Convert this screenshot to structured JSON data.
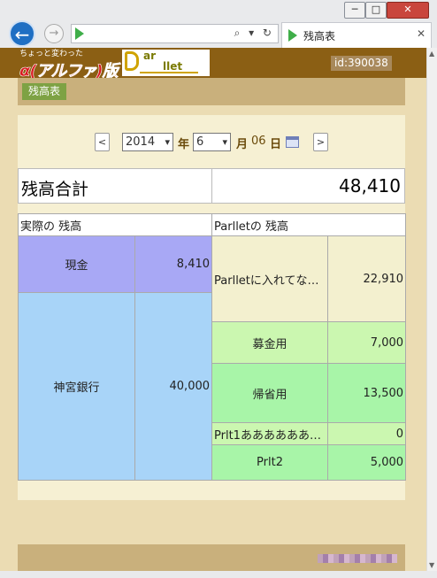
{
  "browser": {
    "tab_title": "残高表",
    "window_buttons": {
      "minimize": "─",
      "maximize": "□",
      "close": "✕"
    },
    "back_icon": "←",
    "forward_icon": "→",
    "address_tools": "⌕ ▾ ↻",
    "tab_close": "✕"
  },
  "header": {
    "logo_tagline": "ちょっと変わった",
    "logo_main": "α(アルファ)版",
    "brand_line1": "ar",
    "brand_line2": "llet",
    "user_id": "id:390038"
  },
  "nav": {
    "active_tab": "残高表"
  },
  "date": {
    "prev_label": "<",
    "next_label": ">",
    "year": "2014",
    "year_unit": "年",
    "month": "6",
    "month_unit": "月",
    "day": "06",
    "day_unit": "日",
    "dropdown_icon": "▾"
  },
  "total": {
    "label": "残高合計",
    "value": "48,410"
  },
  "table": {
    "left_header": "実際の 残高",
    "right_header": "Parlletの 残高",
    "actual": [
      {
        "name": "現金",
        "amount": "8,410"
      },
      {
        "name": "神宮銀行",
        "amount": "40,000"
      }
    ],
    "parllet": [
      {
        "name": "Parlletに入れてな…",
        "amount": "22,910"
      },
      {
        "name": "募金用",
        "amount": "7,000"
      },
      {
        "name": "帰省用",
        "amount": "13,500"
      },
      {
        "name": "Prlt1あああああああ…",
        "amount": "0"
      },
      {
        "name": "Prlt2",
        "amount": "5,000"
      }
    ]
  },
  "colors": {
    "header_brown": "#8b5f14",
    "page_bg": "#ebdcb3",
    "cash_cell": "#a8a8f5",
    "bank_cell": "#a8d4f8",
    "parllet_unassigned": "#f3f0cf",
    "parllet_light_green": "#cbf7b0",
    "parllet_green": "#a8f5a8",
    "active_tab": "#7ea244"
  }
}
